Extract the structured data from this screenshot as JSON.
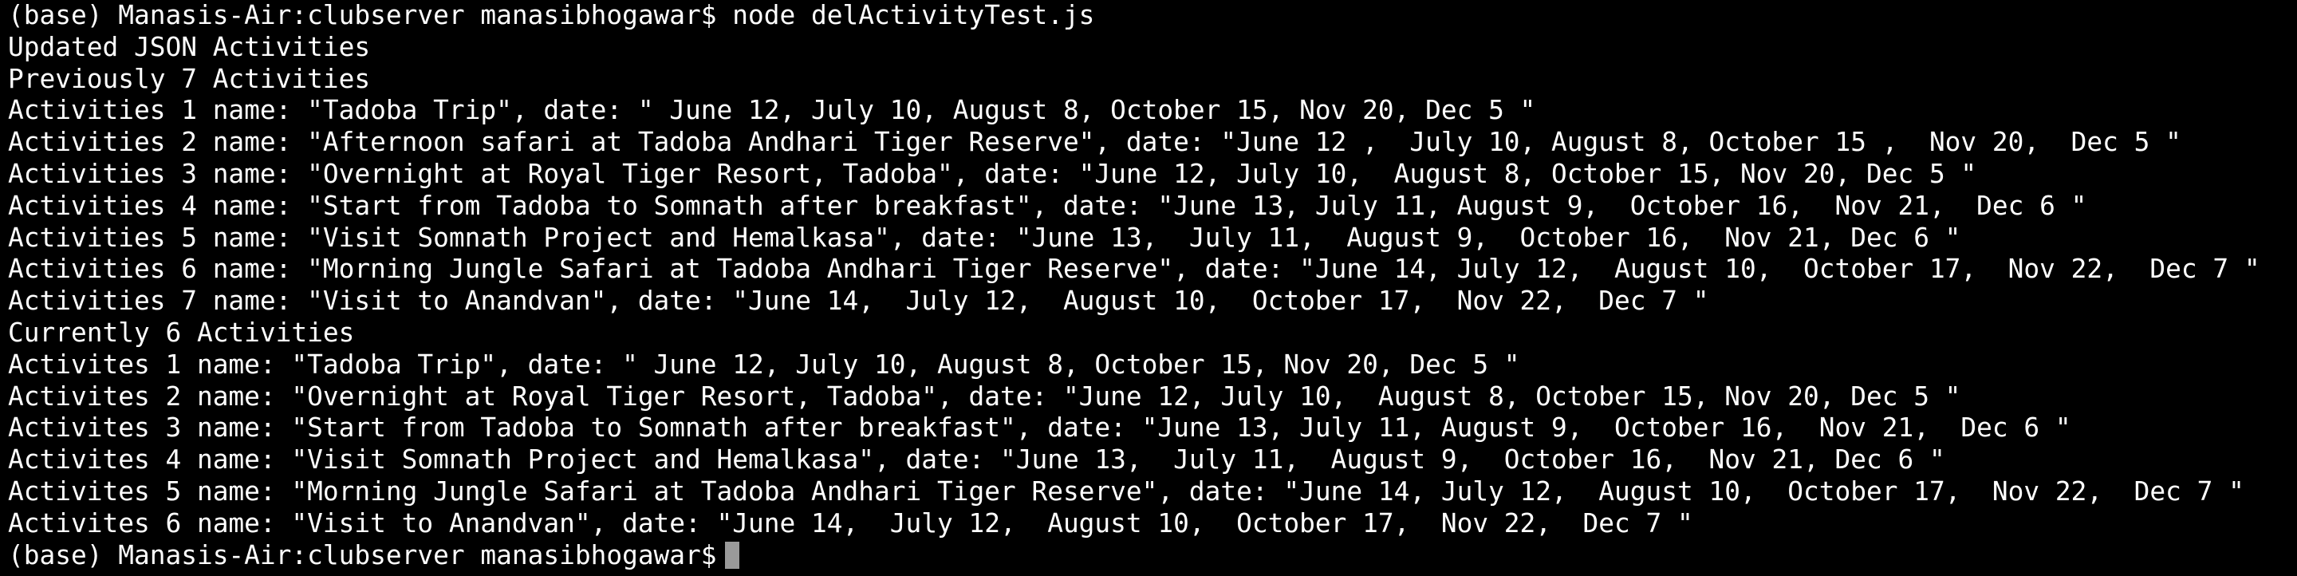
{
  "terminal": {
    "lines": [
      "(base) Manasis-Air:clubserver manasibhogawar$ node delActivityTest.js",
      "Updated JSON Activities",
      "Previously 7 Activities",
      "Activities 1 name: \"Tadoba Trip\", date: \" June 12, July 10, August 8, October 15, Nov 20, Dec 5 \"",
      "Activities 2 name: \"Afternoon safari at Tadoba Andhari Tiger Reserve\", date: \"June 12 ,  July 10, August 8, October 15 ,  Nov 20,  Dec 5 \"",
      "Activities 3 name: \"Overnight at Royal Tiger Resort, Tadoba\", date: \"June 12, July 10,  August 8, October 15, Nov 20, Dec 5 \"",
      "Activities 4 name: \"Start from Tadoba to Somnath after breakfast\", date: \"June 13, July 11, August 9,  October 16,  Nov 21,  Dec 6 \"",
      "Activities 5 name: \"Visit Somnath Project and Hemalkasa\", date: \"June 13,  July 11,  August 9,  October 16,  Nov 21, Dec 6 \"",
      "Activities 6 name: \"Morning Jungle Safari at Tadoba Andhari Tiger Reserve\", date: \"June 14, July 12,  August 10,  October 17,  Nov 22,  Dec 7 \"",
      "Activities 7 name: \"Visit to Anandvan\", date: \"June 14,  July 12,  August 10,  October 17,  Nov 22,  Dec 7 \"",
      "Currently 6 Activities",
      "Activites 1 name: \"Tadoba Trip\", date: \" June 12, July 10, August 8, October 15, Nov 20, Dec 5 \"",
      "Activites 2 name: \"Overnight at Royal Tiger Resort, Tadoba\", date: \"June 12, July 10,  August 8, October 15, Nov 20, Dec 5 \"",
      "Activites 3 name: \"Start from Tadoba to Somnath after breakfast\", date: \"June 13, July 11, August 9,  October 16,  Nov 21,  Dec 6 \"",
      "Activites 4 name: \"Visit Somnath Project and Hemalkasa\", date: \"June 13,  July 11,  August 9,  October 16,  Nov 21, Dec 6 \"",
      "Activites 5 name: \"Morning Jungle Safari at Tadoba Andhari Tiger Reserve\", date: \"June 14, July 12,  August 10,  October 17,  Nov 22,  Dec 7 \"",
      "Activites 6 name: \"Visit to Anandvan\", date: \"June 14,  July 12,  August 10,  October 17,  Nov 22,  Dec 7 \""
    ],
    "prompt": "(base) Manasis-Air:clubserver manasibhogawar$",
    "colors": {
      "background": "#000000",
      "text": "#ffffff",
      "cursor": "#9a9a9a"
    }
  }
}
